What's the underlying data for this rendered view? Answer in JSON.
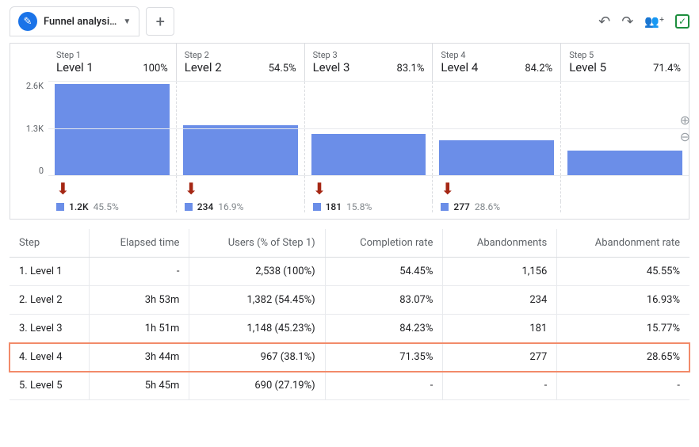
{
  "toolbar": {
    "tab_title": "Funnel analysi…"
  },
  "chart_data": {
    "type": "bar",
    "ylabel": "",
    "ylim": [
      0,
      2600
    ],
    "yticks": [
      "2.6K",
      "1.3K",
      "0"
    ],
    "categories": [
      "Level 1",
      "Level 2",
      "Level 3",
      "Level 4",
      "Level 5"
    ],
    "values": [
      2538,
      1382,
      1148,
      967,
      690
    ]
  },
  "steps": [
    {
      "label": "Step 1",
      "name": "Level 1",
      "pct": "100%",
      "drop_count": "1.2K",
      "drop_pct": "45.5%"
    },
    {
      "label": "Step 2",
      "name": "Level 2",
      "pct": "54.5%",
      "drop_count": "234",
      "drop_pct": "16.9%"
    },
    {
      "label": "Step 3",
      "name": "Level 3",
      "pct": "83.1%",
      "drop_count": "181",
      "drop_pct": "15.8%"
    },
    {
      "label": "Step 4",
      "name": "Level 4",
      "pct": "84.2%",
      "drop_count": "277",
      "drop_pct": "28.6%"
    },
    {
      "label": "Step 5",
      "name": "Level 5",
      "pct": "71.4%",
      "drop_count": "",
      "drop_pct": ""
    }
  ],
  "table": {
    "headers": [
      "Step",
      "Elapsed time",
      "Users (% of Step 1)",
      "Completion rate",
      "Abandonments",
      "Abandonment rate"
    ],
    "rows": [
      {
        "step": "1. Level 1",
        "elapsed": "-",
        "users": "2,538 (100%)",
        "completion": "54.45%",
        "aband": "1,156",
        "aband_rate": "45.55%",
        "highlight": false
      },
      {
        "step": "2. Level 2",
        "elapsed": "3h 53m",
        "users": "1,382 (54.45%)",
        "completion": "83.07%",
        "aband": "234",
        "aband_rate": "16.93%",
        "highlight": false
      },
      {
        "step": "3. Level 3",
        "elapsed": "1h 51m",
        "users": "1,148 (45.23%)",
        "completion": "84.23%",
        "aband": "181",
        "aband_rate": "15.77%",
        "highlight": false
      },
      {
        "step": "4. Level 4",
        "elapsed": "3h 44m",
        "users": "967 (38.1%)",
        "completion": "71.35%",
        "aband": "277",
        "aband_rate": "28.65%",
        "highlight": true
      },
      {
        "step": "5. Level 5",
        "elapsed": "5h 45m",
        "users": "690 (27.19%)",
        "completion": "-",
        "aband": "-",
        "aband_rate": "-",
        "highlight": false
      }
    ]
  }
}
